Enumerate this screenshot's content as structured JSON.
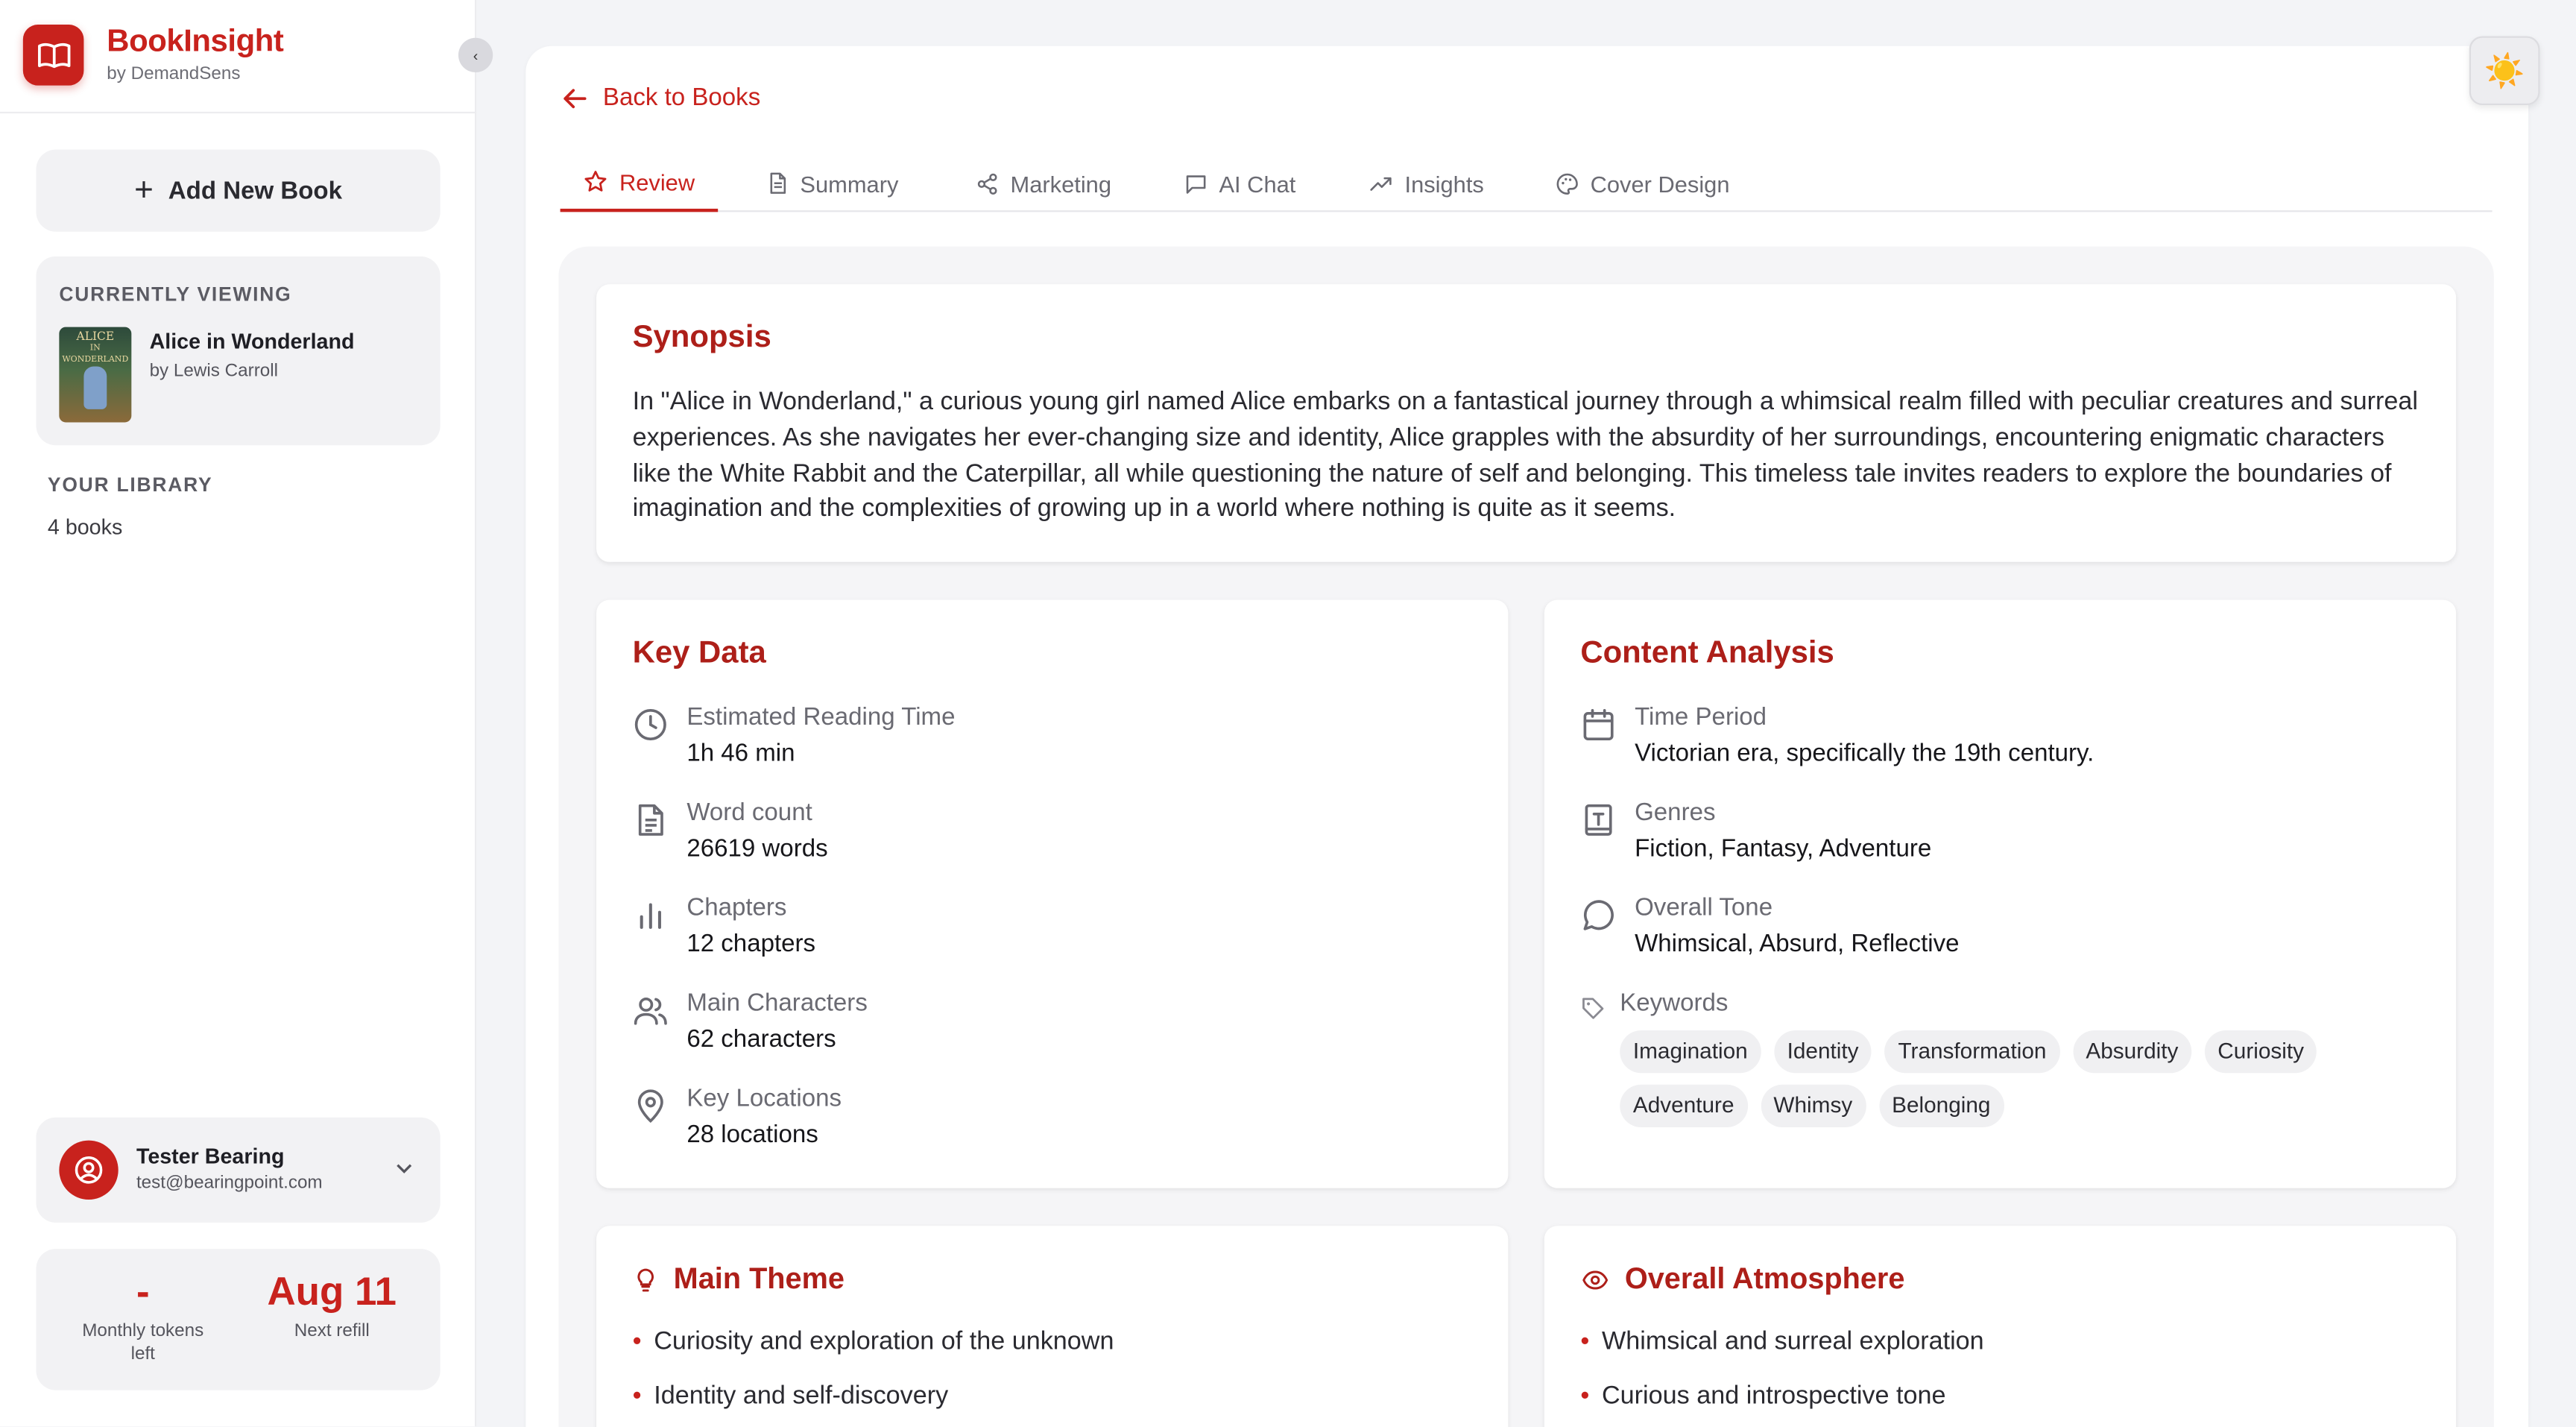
{
  "brand": {
    "name": "BookInsight",
    "sub": "by DemandSens",
    "collapse": "‹"
  },
  "sidebar": {
    "add_book": "Add New Book",
    "currently_viewing_label": "CURRENTLY VIEWING",
    "book": {
      "title": "Alice in Wonderland",
      "author": "by Lewis Carroll",
      "cover_text_1": "ALICE",
      "cover_text_2": "IN WONDERLAND"
    },
    "library_label": "YOUR LIBRARY",
    "library_count": "4 books",
    "user": {
      "name": "Tester Bearing",
      "email": "test@bearingpoint.com"
    },
    "tokens": {
      "value": "-",
      "label": "Monthly tokens left",
      "refill_value": "Aug 11",
      "refill_label": "Next refill"
    }
  },
  "main": {
    "back": "Back to Books",
    "tabs": [
      {
        "label": "Review",
        "icon": "star-icon"
      },
      {
        "label": "Summary",
        "icon": "document-icon"
      },
      {
        "label": "Marketing",
        "icon": "share-icon"
      },
      {
        "label": "AI Chat",
        "icon": "chat-icon"
      },
      {
        "label": "Insights",
        "icon": "trending-icon"
      },
      {
        "label": "Cover Design",
        "icon": "palette-icon"
      }
    ],
    "synopsis": {
      "title": "Synopsis",
      "text": "In \"Alice in Wonderland,\" a curious young girl named Alice embarks on a fantastical journey through a whimsical realm filled with peculiar creatures and surreal experiences. As she navigates her ever-changing size and identity, Alice grapples with the absurdity of her surroundings, encountering enigmatic characters like the White Rabbit and the Caterpillar, all while questioning the nature of self and belonging. This timeless tale invites readers to explore the boundaries of imagination and the complexities of growing up in a world where nothing is quite as it seems."
    },
    "key_data": {
      "title": "Key Data",
      "items": [
        {
          "label": "Estimated Reading Time",
          "value": "1h 46 min",
          "icon": "clock-icon"
        },
        {
          "label": "Word count",
          "value": "26619 words",
          "icon": "file-text-icon"
        },
        {
          "label": "Chapters",
          "value": "12 chapters",
          "icon": "bar-chart-icon"
        },
        {
          "label": "Main Characters",
          "value": "62 characters",
          "icon": "users-icon"
        },
        {
          "label": "Key Locations",
          "value": "28 locations",
          "icon": "map-pin-icon"
        }
      ]
    },
    "content_analysis": {
      "title": "Content Analysis",
      "items": [
        {
          "label": "Time Period",
          "value": "Victorian era, specifically the 19th century.",
          "icon": "calendar-icon"
        },
        {
          "label": "Genres",
          "value": "Fiction, Fantasy, Adventure",
          "icon": "book-icon"
        },
        {
          "label": "Overall Tone",
          "value": "Whimsical, Absurd, Reflective",
          "icon": "message-icon"
        }
      ],
      "keywords_label": "Keywords",
      "keywords": [
        "Imagination",
        "Identity",
        "Transformation",
        "Absurdity",
        "Curiosity",
        "Adventure",
        "Whimsy",
        "Belonging"
      ]
    },
    "main_theme": {
      "title": "Main Theme",
      "bullets": [
        "Curiosity and exploration of the unknown",
        "Identity and self-discovery"
      ]
    },
    "atmosphere": {
      "title": "Overall Atmosphere",
      "bullets": [
        "Whimsical and surreal exploration",
        "Curious and introspective tone"
      ]
    }
  },
  "colors": {
    "accent": "#c8221d",
    "title_red": "#ad1f19",
    "panel_bg": "#f5f5f7"
  },
  "theme_toggle": "☀️"
}
